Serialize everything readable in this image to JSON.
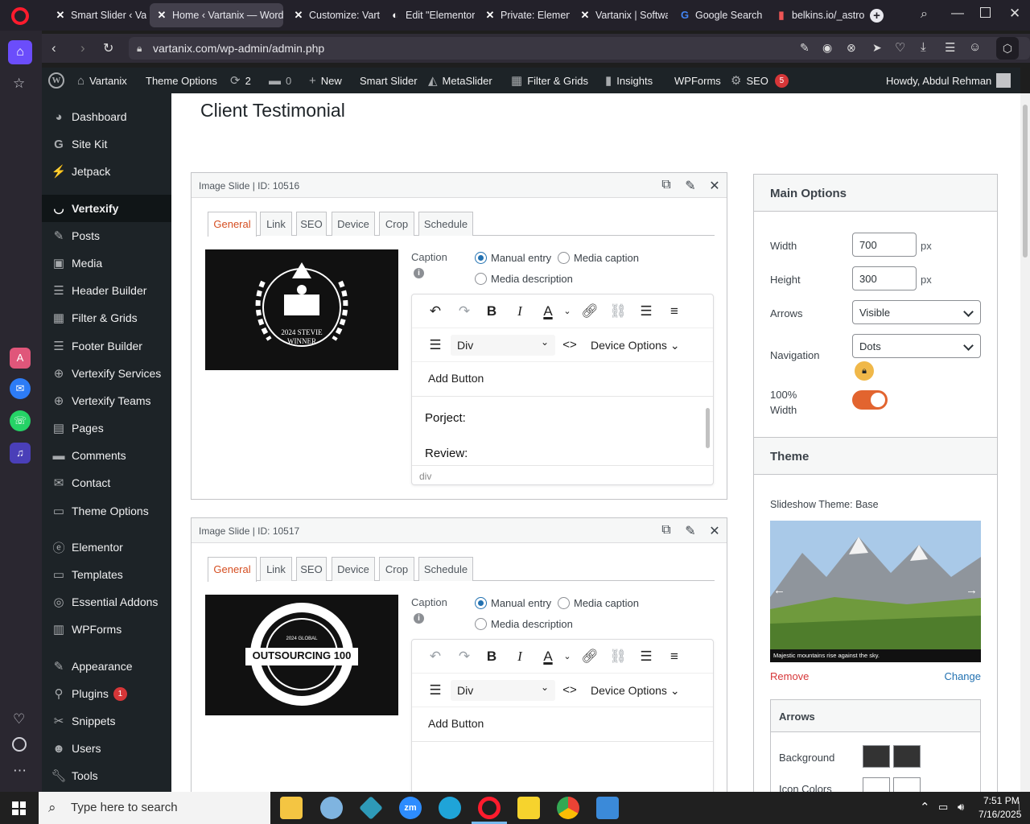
{
  "browser": {
    "tabs": [
      {
        "label": "Smart Slider ‹ Va",
        "icon": "wp-logo-icon"
      },
      {
        "label": "Home ‹ Vartanix — WordP",
        "icon": "wp-logo-icon",
        "active": true
      },
      {
        "label": "Customize: Varta",
        "icon": "wp-logo-icon"
      },
      {
        "label": "Edit \"Elementor I",
        "icon": "wp-logo-icon"
      },
      {
        "label": "Private: Element",
        "icon": "wp-logo-icon"
      },
      {
        "label": "Vartanix | Softwa",
        "icon": "wp-logo-icon"
      },
      {
        "label": "Google Search",
        "icon": "google-icon"
      },
      {
        "label": "belkins.io/_astro/",
        "icon": "page-icon"
      }
    ],
    "url": "vartanix.com/wp-admin/admin.php"
  },
  "adminbar": {
    "site": "Vartanix",
    "theme_options": "Theme Options",
    "updates": "2",
    "comments": "0",
    "new": "New",
    "smart_slider": "Smart Slider",
    "metaslider": "MetaSlider",
    "filter_grids": "Filter & Grids",
    "insights": "Insights",
    "wpforms": "WPForms",
    "seo": "SEO",
    "seo_count": "5",
    "howdy": "Howdy, Abdul Rehman"
  },
  "sidebar": {
    "items": [
      {
        "label": "Dashboard"
      },
      {
        "label": "Site Kit"
      },
      {
        "label": "Jetpack"
      },
      {
        "label": "Vertexify"
      },
      {
        "label": "Posts"
      },
      {
        "label": "Media"
      },
      {
        "label": "Header Builder"
      },
      {
        "label": "Filter & Grids"
      },
      {
        "label": "Footer Builder"
      },
      {
        "label": "Vertexify Services"
      },
      {
        "label": "Vertexify Teams"
      },
      {
        "label": "Pages"
      },
      {
        "label": "Comments"
      },
      {
        "label": "Contact"
      },
      {
        "label": "Theme Options"
      },
      {
        "label": "Elementor"
      },
      {
        "label": "Templates"
      },
      {
        "label": "Essential Addons"
      },
      {
        "label": "WPForms"
      },
      {
        "label": "Appearance"
      },
      {
        "label": "Plugins",
        "badge": "1"
      },
      {
        "label": "Snippets"
      },
      {
        "label": "Users"
      },
      {
        "label": "Tools"
      }
    ]
  },
  "page": {
    "title": "Client Testimonial"
  },
  "slides": [
    {
      "header": "Image Slide | ID: 10516",
      "tabs": [
        "General",
        "Link",
        "SEO",
        "Device",
        "Crop",
        "Schedule"
      ],
      "image_text": "2024 STEVIE WINNER",
      "caption_label": "Caption",
      "radio_manual": "Manual entry",
      "radio_media_caption": "Media caption",
      "radio_media_desc": "Media description",
      "block_format": "Div",
      "device_options": "Device Options",
      "add_button": "Add Button",
      "line1": "Porject:",
      "line2": "Review:",
      "path": "div"
    },
    {
      "header": "Image Slide | ID: 10517",
      "tabs": [
        "General",
        "Link",
        "SEO",
        "Device",
        "Crop",
        "Schedule"
      ],
      "image_text": "OUTSOURCING 100",
      "image_subtext": "2024 GLOBAL",
      "caption_label": "Caption",
      "radio_manual": "Manual entry",
      "radio_media_caption": "Media caption",
      "radio_media_desc": "Media description",
      "block_format": "Div",
      "device_options": "Device Options",
      "add_button": "Add Button"
    }
  ],
  "main_options": {
    "title": "Main Options",
    "width_label": "Width",
    "width_value": "700",
    "height_label": "Height",
    "height_value": "300",
    "unit": "px",
    "arrows_label": "Arrows",
    "arrows_value": "Visible",
    "navigation_label": "Navigation",
    "navigation_value": "Dots",
    "full_width_label_1": "100%",
    "full_width_label_2": "Width",
    "full_width_on": true
  },
  "theme": {
    "title": "Theme",
    "slideshow_theme": "Slideshow Theme: Base",
    "preview_caption": "Majestic mountains rise against the sky.",
    "remove": "Remove",
    "change": "Change",
    "arrows_section": "Arrows",
    "background_label": "Background",
    "icon_colors_label": "Icon Colors"
  },
  "taskbar": {
    "search_placeholder": "Type here to search",
    "time": "7:51 PM",
    "date": "7/16/2025"
  },
  "colors": {
    "wp_dark": "#1d2327",
    "accent_orange": "#d54e21",
    "toggle_orange": "#e2642f",
    "link_blue": "#2271b1",
    "remove_red": "#d63638"
  }
}
